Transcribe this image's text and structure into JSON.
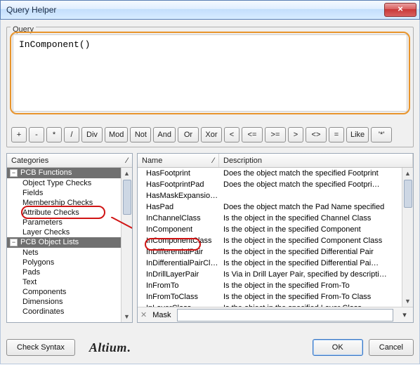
{
  "window": {
    "title": "Query Helper",
    "close_glyph": "×"
  },
  "query": {
    "label": "Query",
    "text": "InComponent()"
  },
  "operators": [
    "+",
    "-",
    "*",
    "/",
    "Div",
    "Mod",
    "Not",
    "And",
    "Or",
    "Xor",
    "<",
    "<=",
    ">=",
    ">",
    "<>",
    "=",
    "Like",
    "'*'"
  ],
  "categories": {
    "header": "Categories",
    "sort_glyph": "⁄",
    "groups": [
      {
        "label": "PCB Functions",
        "items": [
          "Object Type Checks",
          "Fields",
          "Membership Checks",
          "Attribute Checks",
          "Parameters",
          "Layer Checks"
        ]
      },
      {
        "label": "PCB Object Lists",
        "items": [
          "Nets",
          "Polygons",
          "Pads",
          "Text",
          "Components",
          "Dimensions",
          "Coordinates"
        ]
      }
    ]
  },
  "functions": {
    "name_header": "Name",
    "desc_header": "Description",
    "sort_glyph": "⁄",
    "rows": [
      {
        "name": "HasFootprint",
        "desc": "Does the object match the specified Footprint"
      },
      {
        "name": "HasFootprintPad",
        "desc": "Does the object match the specified Footpri…"
      },
      {
        "name": "HasMaskExpansio…",
        "desc": ""
      },
      {
        "name": "HasPad",
        "desc": "Does the object match the Pad Name specified"
      },
      {
        "name": "InChannelClass",
        "desc": "Is the object in the specified Channel Class"
      },
      {
        "name": "InComponent",
        "desc": "Is the object in the specified Component"
      },
      {
        "name": "InComponentClass",
        "desc": "Is the object in the specified Component Class"
      },
      {
        "name": "InDifferentialPair",
        "desc": "Is the object in the specified Differential Pair"
      },
      {
        "name": "InDifferentialPairCl…",
        "desc": "Is the object in the specified Differential Pai…"
      },
      {
        "name": "InDrillLayerPair",
        "desc": "Is Via in Drill Layer Pair, specified by descripti…"
      },
      {
        "name": "InFromTo",
        "desc": "Is the object in the specified From-To"
      },
      {
        "name": "InFromToClass",
        "desc": "Is the object in the specified From-To Class"
      },
      {
        "name": "InLayerClass",
        "desc": "Is the object in the specified Layer Class"
      }
    ]
  },
  "mask": {
    "label": "Mask",
    "value": "",
    "dd_glyph": "▾",
    "clear_glyph": "✕"
  },
  "buttons": {
    "check_syntax": "Check Syntax",
    "ok": "OK",
    "cancel": "Cancel"
  },
  "brand": "Altium",
  "scroll": {
    "up": "▲",
    "down": "▼"
  },
  "tree_toggle": "−"
}
